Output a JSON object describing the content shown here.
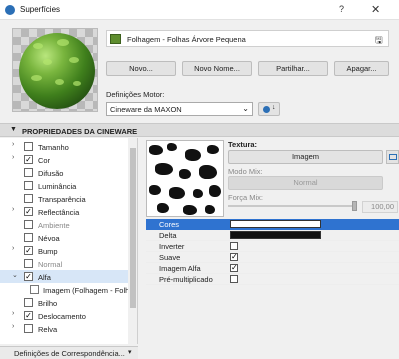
{
  "window": {
    "title": "Superfícies",
    "help": "?",
    "close": "✕"
  },
  "surface": {
    "name": "Folhagem - Folhas Árvore Pequena",
    "swatch_color": "#5e8d2e",
    "icon": "save-disk-icon"
  },
  "buttons": {
    "new": "Novo...",
    "new_name": "Novo Nome...",
    "share": "Partilhar...",
    "delete": "Apagar..."
  },
  "engine": {
    "label": "Definições Motor:",
    "value": "Cineware da MAXON",
    "icon": "sphere-cube-icon"
  },
  "section": {
    "title": "PROPRIEDADES DA CINEWARE"
  },
  "channels": [
    {
      "label": "Tamanho",
      "checked": false,
      "expand": "›",
      "selected": false,
      "dim": false
    },
    {
      "label": "Cor",
      "checked": true,
      "expand": "›",
      "selected": false,
      "dim": false
    },
    {
      "label": "Difusão",
      "checked": false,
      "expand": "",
      "selected": false,
      "dim": false
    },
    {
      "label": "Luminância",
      "checked": false,
      "expand": "",
      "selected": false,
      "dim": false
    },
    {
      "label": "Transparência",
      "checked": false,
      "expand": "",
      "selected": false,
      "dim": false
    },
    {
      "label": "Reflectância",
      "checked": true,
      "expand": "›",
      "selected": false,
      "dim": false
    },
    {
      "label": "Ambiente",
      "checked": false,
      "expand": "",
      "selected": false,
      "dim": true
    },
    {
      "label": "Névoa",
      "checked": false,
      "expand": "",
      "selected": false,
      "dim": false
    },
    {
      "label": "Bump",
      "checked": true,
      "expand": "›",
      "selected": false,
      "dim": false
    },
    {
      "label": "Normal",
      "checked": false,
      "expand": "",
      "selected": false,
      "dim": true
    },
    {
      "label": "Alfa",
      "checked": true,
      "expand": "⌄",
      "selected": true,
      "dim": false
    },
    {
      "child": true,
      "label": "Imagem (Folhagem - Folhas"
    },
    {
      "label": "Brilho",
      "checked": false,
      "expand": "",
      "selected": false,
      "dim": false
    },
    {
      "label": "Deslocamento",
      "checked": true,
      "expand": "›",
      "selected": false,
      "dim": false
    },
    {
      "label": "Relva",
      "checked": false,
      "expand": "›",
      "selected": false,
      "dim": false
    }
  ],
  "mapping": {
    "label": "Definições de Correspondência...",
    "arrow": "▾"
  },
  "texture": {
    "label": "Textura:",
    "image_button": "Imagem",
    "mix_mode_label": "Modo Mix:",
    "mix_mode_value": "Normal",
    "mix_strength_label": "Força Mix:",
    "mix_strength_value": "100,00",
    "mix_strength_level": 1.0
  },
  "properties": [
    {
      "label": "Cores",
      "kind": "color",
      "color": "#ffffff",
      "selected": true
    },
    {
      "label": "Delta",
      "kind": "color",
      "color": "#111111",
      "selected": false
    },
    {
      "label": "Inverter",
      "kind": "check",
      "checked": false,
      "selected": false
    },
    {
      "label": "Suave",
      "kind": "check",
      "checked": true,
      "selected": false
    },
    {
      "label": "Imagem Alfa",
      "kind": "check",
      "checked": true,
      "selected": false
    },
    {
      "label": "Pré-multiplicado",
      "kind": "check",
      "checked": false,
      "selected": false
    }
  ]
}
